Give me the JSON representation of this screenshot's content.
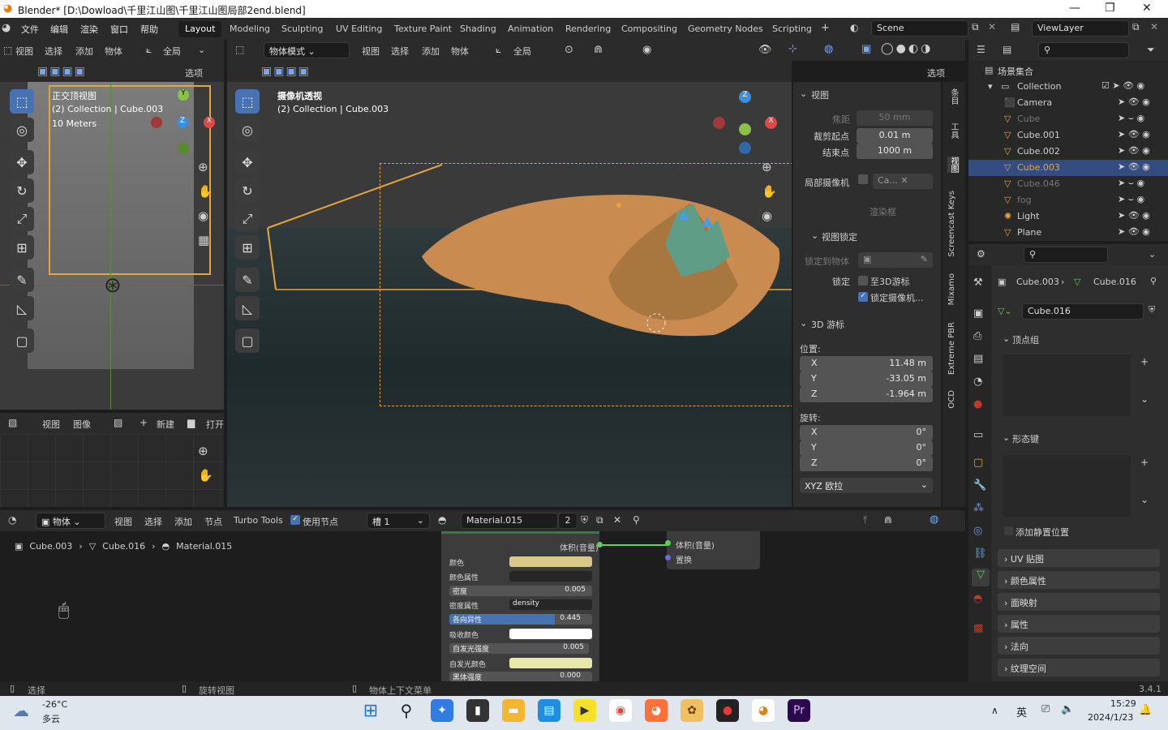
{
  "window": {
    "title": "Blender* [D:\\Dowload\\千里江山图\\千里江山图局部2end.blend]"
  },
  "menu": {
    "items": [
      "文件",
      "编辑",
      "渲染",
      "窗口",
      "帮助"
    ]
  },
  "workspaces": [
    "Layout",
    "Modeling",
    "Sculpting",
    "UV Editing",
    "Texture Paint",
    "Shading",
    "Animation",
    "Rendering",
    "Compositing",
    "Geometry Nodes",
    "Scripting",
    "+"
  ],
  "scene": {
    "name": "Scene",
    "view_layer": "ViewLayer"
  },
  "left_viewport": {
    "header": [
      "视图",
      "选择",
      "添加",
      "物体"
    ],
    "transform": "全局",
    "options": "选项",
    "title": "正交顶视图",
    "collection": "(2) Collection | Cube.003",
    "scale": "10 Meters"
  },
  "main_viewport": {
    "mode": "物体模式",
    "header": [
      "视图",
      "选择",
      "添加",
      "物体"
    ],
    "transform": "全局",
    "options": "选项",
    "title": "摄像机透视",
    "collection": "(2) Collection | Cube.003"
  },
  "n_panel": {
    "section_view": "视图",
    "focal_label": "焦距",
    "focal": "50 mm",
    "clip_start_label": "裁剪起点",
    "clip_start": "0.01 m",
    "clip_end_label": "结束点",
    "clip_end": "1000 m",
    "local_camera_label": "局部摄像机",
    "local_camera": "Ca...",
    "render_region": "渲染框",
    "section_lock": "视图锁定",
    "lock_to_object": "锁定到物体",
    "lock_label": "锁定",
    "lock_cursor": "至3D游标",
    "lock_camera": "锁定摄像机...",
    "section_cursor": "3D 游标",
    "location_label": "位置:",
    "loc_x": "11.48 m",
    "loc_y": "-33.05 m",
    "loc_z": "-1.964 m",
    "rotation_label": "旋转:",
    "rot_x": "0°",
    "rot_y": "0°",
    "rot_z": "0°",
    "rotation_mode": "XYZ 欧拉",
    "tabs": [
      "条目",
      "工具",
      "视图",
      "Screencast Keys",
      "Mixamo",
      "Extreme PBR",
      "OCD"
    ]
  },
  "image_editor": {
    "header": [
      "视图",
      "图像"
    ],
    "new": "新建",
    "open": "打开"
  },
  "node_editor": {
    "type": "物体",
    "header": [
      "视图",
      "选择",
      "添加",
      "节点"
    ],
    "turbo": "Turbo Tools",
    "use_nodes": "使用节点",
    "slot": "槽 1",
    "material": "Material.015",
    "users": "2",
    "breadcrumb": [
      "Cube.003",
      "Cube.016",
      "Material.015"
    ],
    "output_socket": "体积(音量)",
    "rows": [
      {
        "label": "颜色",
        "value": ""
      },
      {
        "label": "颜色属性",
        "value": ""
      },
      {
        "label": "密度",
        "value": "0.005"
      },
      {
        "label": "密度属性",
        "value": "density"
      },
      {
        "label": "各向异性",
        "value": "0.445"
      },
      {
        "label": "吸收颜色",
        "value": ""
      },
      {
        "label": "自发光强度",
        "value": "0.005"
      },
      {
        "label": "自发光颜色",
        "value": ""
      },
      {
        "label": "黑体强度",
        "value": "0.000"
      }
    ],
    "out_node": [
      "体积(音量)",
      "置换"
    ]
  },
  "outliner": {
    "root": "场景集合",
    "collection": "Collection",
    "items": [
      "Camera",
      "Cube",
      "Cube.001",
      "Cube.002",
      "Cube.003",
      "Cube.046",
      "fog",
      "Light",
      "Plane"
    ]
  },
  "properties": {
    "breadcrumb_obj": "Cube.003",
    "breadcrumb_data": "Cube.016",
    "mesh_name": "Cube.016",
    "vertex_groups": "顶点组",
    "shape_keys": "形态键",
    "rest_position": "添加静置位置",
    "sections": [
      "UV 贴图",
      "颜色属性",
      "面映射",
      "属性",
      "法向",
      "纹理空间"
    ]
  },
  "statusbar": {
    "select": "选择",
    "rotate": "旋转视图",
    "context": "物体上下文菜单",
    "version": "3.4.1"
  },
  "taskbar": {
    "temp": "-26°C",
    "weather": "多云",
    "ime": "英",
    "time": "15:29",
    "date": "2024/1/23"
  },
  "colors": {
    "accent": "#4772b3",
    "selected_row": "#334d80",
    "active_orange": "#e8a33c"
  }
}
